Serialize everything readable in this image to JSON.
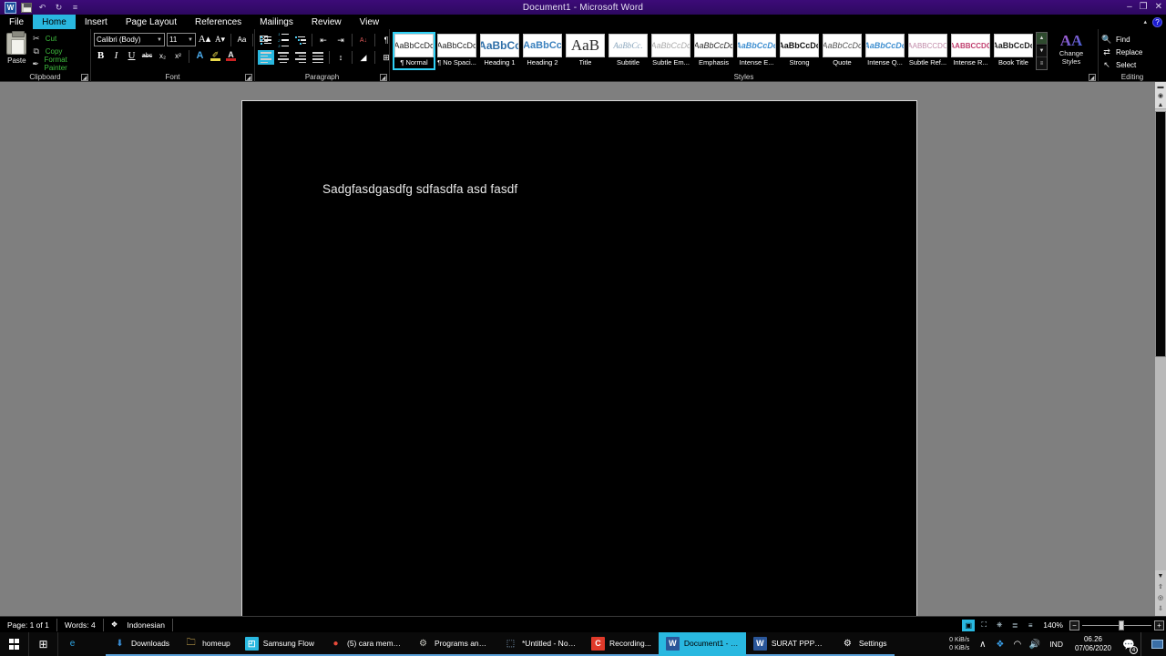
{
  "window": {
    "title": "Document1 - Microsoft Word",
    "quick_access": [
      {
        "name": "word-icon",
        "glyph": "W"
      },
      {
        "name": "save-icon",
        "glyph": ""
      },
      {
        "name": "undo-icon",
        "glyph": "↶"
      },
      {
        "name": "redo-icon",
        "glyph": "↻"
      },
      {
        "name": "customize-qat-icon",
        "glyph": "≡"
      }
    ],
    "controls": {
      "minimize": "–",
      "restore": "❐",
      "close": "✕"
    },
    "ribbon_collapse": "▴",
    "help": "?"
  },
  "tabs": [
    {
      "label": "File",
      "active": false
    },
    {
      "label": "Home",
      "active": true
    },
    {
      "label": "Insert",
      "active": false
    },
    {
      "label": "Page Layout",
      "active": false
    },
    {
      "label": "References",
      "active": false
    },
    {
      "label": "Mailings",
      "active": false
    },
    {
      "label": "Review",
      "active": false
    },
    {
      "label": "View",
      "active": false
    }
  ],
  "ribbon": {
    "clipboard": {
      "group_label": "Clipboard",
      "paste_label": "Paste",
      "commands": [
        {
          "label": "Cut",
          "icon": "✂"
        },
        {
          "label": "Copy",
          "icon": "⧉"
        },
        {
          "label": "Format Painter",
          "icon": "✒"
        }
      ]
    },
    "font": {
      "group_label": "Font",
      "font_name": "Calibri (Body)",
      "font_size": "11",
      "buttons_row1": [
        {
          "name": "grow-font-icon",
          "glyph": "A▴"
        },
        {
          "name": "shrink-font-icon",
          "glyph": "A▾"
        },
        {
          "name": "change-case-icon",
          "glyph": "Aa"
        },
        {
          "name": "clear-formatting-icon",
          "glyph": "⌧"
        }
      ],
      "buttons_row2": [
        {
          "name": "bold-icon",
          "glyph": "B"
        },
        {
          "name": "italic-icon",
          "glyph": "I"
        },
        {
          "name": "underline-icon",
          "glyph": "U"
        },
        {
          "name": "strikethrough-icon",
          "glyph": "abc"
        },
        {
          "name": "subscript-icon",
          "glyph": "x₂"
        },
        {
          "name": "superscript-icon",
          "glyph": "x²"
        },
        {
          "name": "text-effects-icon",
          "glyph": "A"
        },
        {
          "name": "text-highlight-icon",
          "glyph": "✐"
        },
        {
          "name": "font-color-icon",
          "glyph": "A"
        }
      ]
    },
    "paragraph": {
      "group_label": "Paragraph",
      "buttons_row1": [
        {
          "name": "bullets-icon"
        },
        {
          "name": "numbering-icon"
        },
        {
          "name": "multilevel-list-icon"
        },
        {
          "name": "decrease-indent-icon",
          "glyph": "⇤"
        },
        {
          "name": "increase-indent-icon",
          "glyph": "⇥"
        },
        {
          "name": "sort-icon",
          "glyph": "A↓"
        },
        {
          "name": "show-formatting-marks-icon",
          "glyph": "¶"
        }
      ],
      "buttons_row2": [
        {
          "name": "align-left-icon",
          "active": true
        },
        {
          "name": "align-center-icon",
          "active": false
        },
        {
          "name": "align-right-icon",
          "active": false
        },
        {
          "name": "justify-icon",
          "active": false
        },
        {
          "name": "line-spacing-icon",
          "glyph": "↕"
        },
        {
          "name": "shading-icon",
          "glyph": "◢"
        },
        {
          "name": "borders-icon",
          "glyph": "⊞"
        }
      ]
    },
    "styles": {
      "group_label": "Styles",
      "gallery": [
        {
          "name": "Normal",
          "display_name": "¶ Normal",
          "preview": "AaBbCcDc",
          "selected": true,
          "color": "#1f1f1f",
          "size": "9px",
          "weight": "normal",
          "style": "normal"
        },
        {
          "name": "No Spacing",
          "display_name": "¶ No Spaci...",
          "preview": "AaBbCcDc",
          "selected": false,
          "color": "#1f1f1f",
          "size": "9px",
          "weight": "normal",
          "style": "normal"
        },
        {
          "name": "Heading 1",
          "display_name": "Heading 1",
          "preview": "AaBbCс",
          "selected": false,
          "color": "#2f6fa8",
          "size": "12px",
          "weight": "bold",
          "style": "normal"
        },
        {
          "name": "Heading 2",
          "display_name": "Heading 2",
          "preview": "AaBbCc",
          "selected": false,
          "color": "#3c82be",
          "size": "11px",
          "weight": "bold",
          "style": "normal"
        },
        {
          "name": "Title",
          "display_name": "Title",
          "preview": "AaB",
          "selected": false,
          "color": "#2a2a2a",
          "size": "17px",
          "weight": "normal",
          "style": "normal"
        },
        {
          "name": "Subtitle",
          "display_name": "Subtitle",
          "preview": "AaBbCc.",
          "selected": false,
          "color": "#8aa6bd",
          "size": "9px",
          "weight": "normal",
          "style": "italic"
        },
        {
          "name": "Subtle Emphasis",
          "display_name": "Subtle Em...",
          "preview": "AaBbCcDc",
          "selected": false,
          "color": "#aaaaaa",
          "size": "9px",
          "weight": "normal",
          "style": "italic"
        },
        {
          "name": "Emphasis",
          "display_name": "Emphasis",
          "preview": "AaBbCcDc",
          "selected": false,
          "color": "#2a2a2a",
          "size": "9px",
          "weight": "normal",
          "style": "italic"
        },
        {
          "name": "Intense Emphasis",
          "display_name": "Intense E...",
          "preview": "AaBbCcDc",
          "selected": false,
          "color": "#3f8fd0",
          "size": "9px",
          "weight": "bold",
          "style": "italic"
        },
        {
          "name": "Strong",
          "display_name": "Strong",
          "preview": "AaBbCcDc",
          "selected": false,
          "color": "#111111",
          "size": "9px",
          "weight": "bold",
          "style": "normal"
        },
        {
          "name": "Quote",
          "display_name": "Quote",
          "preview": "AaBbCcDc",
          "selected": false,
          "color": "#555555",
          "size": "9px",
          "weight": "normal",
          "style": "italic"
        },
        {
          "name": "Intense Quote",
          "display_name": "Intense Q...",
          "preview": "AaBbCcDc",
          "selected": false,
          "color": "#3f8fd0",
          "size": "9px",
          "weight": "bold",
          "style": "italic"
        },
        {
          "name": "Subtle Reference",
          "display_name": "Subtle Ref...",
          "preview": "AABBCCDC",
          "selected": false,
          "color": "#c08aa8",
          "size": "8px",
          "weight": "normal",
          "style": "normal"
        },
        {
          "name": "Intense Reference",
          "display_name": "Intense R...",
          "preview": "AABBCCDC",
          "selected": false,
          "color": "#c03f6f",
          "size": "8px",
          "weight": "bold",
          "style": "normal"
        },
        {
          "name": "Book Title",
          "display_name": "Book Title",
          "preview": "AaBbCcDc",
          "selected": false,
          "color": "#1f1f1f",
          "size": "9px",
          "weight": "bold",
          "style": "normal"
        }
      ],
      "scroll_up": "▲",
      "scroll_down": "▼",
      "more": "≡",
      "change_styles_label_line1": "Change",
      "change_styles_label_line2": "Styles",
      "change_styles_icon": "AA"
    },
    "editing": {
      "group_label": "Editing",
      "commands": [
        {
          "label": "Find",
          "icon": "🔍"
        },
        {
          "label": "Replace",
          "icon": "⇄"
        },
        {
          "label": "Select",
          "icon": "↖"
        }
      ]
    }
  },
  "document": {
    "body_text": "Sadgfasdgasdfg sdfasdfa asd fasdf"
  },
  "statusbar": {
    "page": "Page: 1 of 1",
    "words": "Words: 4",
    "proofing_icon": "❖",
    "language": "Indonesian",
    "views": [
      {
        "name": "print-layout",
        "glyph": "▣",
        "active": true
      },
      {
        "name": "full-screen-reading",
        "glyph": "⛶",
        "active": false
      },
      {
        "name": "web-layout",
        "glyph": "⎈",
        "active": false
      },
      {
        "name": "outline",
        "glyph": "≣",
        "active": false
      },
      {
        "name": "draft",
        "glyph": "≡",
        "active": false
      }
    ],
    "zoom": "140%",
    "zoom_out": "−",
    "zoom_in": "+"
  },
  "taskbar": {
    "start_label": "Start",
    "task_view_label": "Task View",
    "apps": [
      {
        "label": "",
        "icon": "e",
        "icon_bg": "transparent",
        "icon_color": "#2fa8e8",
        "state": "none",
        "name": "edge"
      },
      {
        "label": "Downloads",
        "icon": "⬇",
        "icon_bg": "transparent",
        "icon_color": "#3a8fd8",
        "state": "open",
        "name": "downloads"
      },
      {
        "label": "homeup",
        "icon": "🗀",
        "icon_bg": "transparent",
        "icon_color": "#e8c05a",
        "state": "open",
        "name": "homeup"
      },
      {
        "label": "Samsung Flow",
        "icon": "◰",
        "icon_bg": "#29b8e0",
        "icon_color": "#ffffff",
        "state": "open",
        "name": "samsung-flow"
      },
      {
        "label": "(5) cara membu...",
        "icon": "●",
        "icon_bg": "transparent",
        "icon_color": "#e84a3a",
        "state": "open",
        "name": "chrome"
      },
      {
        "label": "Programs and F...",
        "icon": "⚙",
        "icon_bg": "transparent",
        "icon_color": "#c8c8c0",
        "state": "open",
        "name": "programs-and-features"
      },
      {
        "label": "*Untitled - Note...",
        "icon": "⬚",
        "icon_bg": "transparent",
        "icon_color": "#9ec4e8",
        "state": "open",
        "name": "notepad"
      },
      {
        "label": "Recording...",
        "icon": "C",
        "icon_bg": "#e03a2a",
        "icon_color": "#ffffff",
        "state": "open",
        "name": "recording"
      },
      {
        "label": "Document1 - M...",
        "icon": "W",
        "icon_bg": "#2a5699",
        "icon_color": "#ffffff",
        "state": "active",
        "name": "word-document1"
      },
      {
        "label": "SURAT PPPK [C...",
        "icon": "W",
        "icon_bg": "#2a5699",
        "icon_color": "#ffffff",
        "state": "open",
        "name": "word-surat-pppk"
      },
      {
        "label": "Settings",
        "icon": "⚙",
        "icon_bg": "transparent",
        "icon_color": "#ffffff",
        "state": "open",
        "name": "settings"
      }
    ],
    "tray": {
      "net_up": "0 KiB/s",
      "net_down": "0 KiB/s",
      "show_hidden": "∧",
      "icons": [
        {
          "name": "dropbox-icon",
          "glyph": "❖",
          "color": "#3a9fe8"
        },
        {
          "name": "wifi-icon",
          "glyph": "◠",
          "color": "#d8d8d8"
        },
        {
          "name": "volume-icon",
          "glyph": "🔊",
          "color": "#e8e8e8"
        }
      ],
      "input_indicator": "IND",
      "time": "06.26",
      "date": "07/06/2020",
      "action_center_icon": "💬",
      "notification_count": "4"
    }
  },
  "colors": {
    "accent": "#29b8e0",
    "titlebar": "#350a6c",
    "doc_bg": "#7f7f7f",
    "page_bg": "#000000"
  }
}
